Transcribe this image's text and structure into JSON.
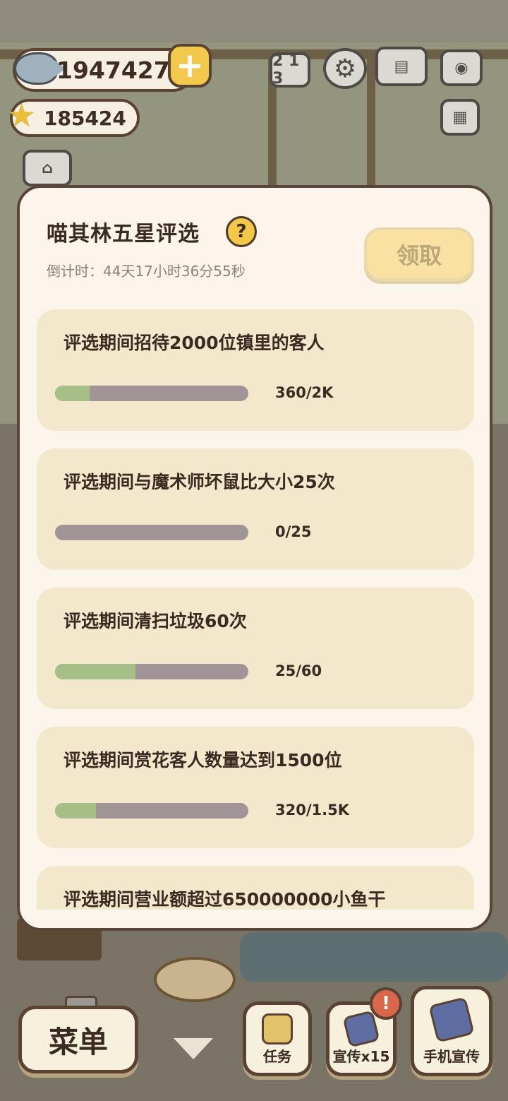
{
  "hud": {
    "fish_count": "1947427",
    "star_count": "185424"
  },
  "top_icons": {
    "rank_label": "2 1 3"
  },
  "panel": {
    "title": "喵其林五星评选",
    "help": "?",
    "countdown": "倒计时：44天17小时36分55秒",
    "claim_label": "领取",
    "tasks": [
      {
        "title": "评选期间招待2000位镇里的客人",
        "progress_text": "360/2K",
        "progress": 0.18
      },
      {
        "title": "评选期间与魔术师坏鼠比大小25次",
        "progress_text": "0/25",
        "progress": 0.0
      },
      {
        "title": "评选期间清扫垃圾60次",
        "progress_text": "25/60",
        "progress": 0.4167
      },
      {
        "title": "评选期间赏花客人数量达到1500位",
        "progress_text": "320/1.5K",
        "progress": 0.2133
      },
      {
        "title": "评选期间营业额超过650000000小鱼干",
        "progress_text": "",
        "progress": 0.0
      }
    ]
  },
  "bottom": {
    "menu_label": "菜单",
    "task_label": "任务",
    "promo_label": "宣传x15",
    "phone_promo_label": "手机宣传",
    "badge": "!"
  },
  "colors": {
    "panel_bg": "#fbf5ec",
    "card_bg": "#f4e8cc",
    "progress_fill": "#a6bf86",
    "progress_track": "#a19496",
    "claim_bg": "#f8e1a3"
  }
}
